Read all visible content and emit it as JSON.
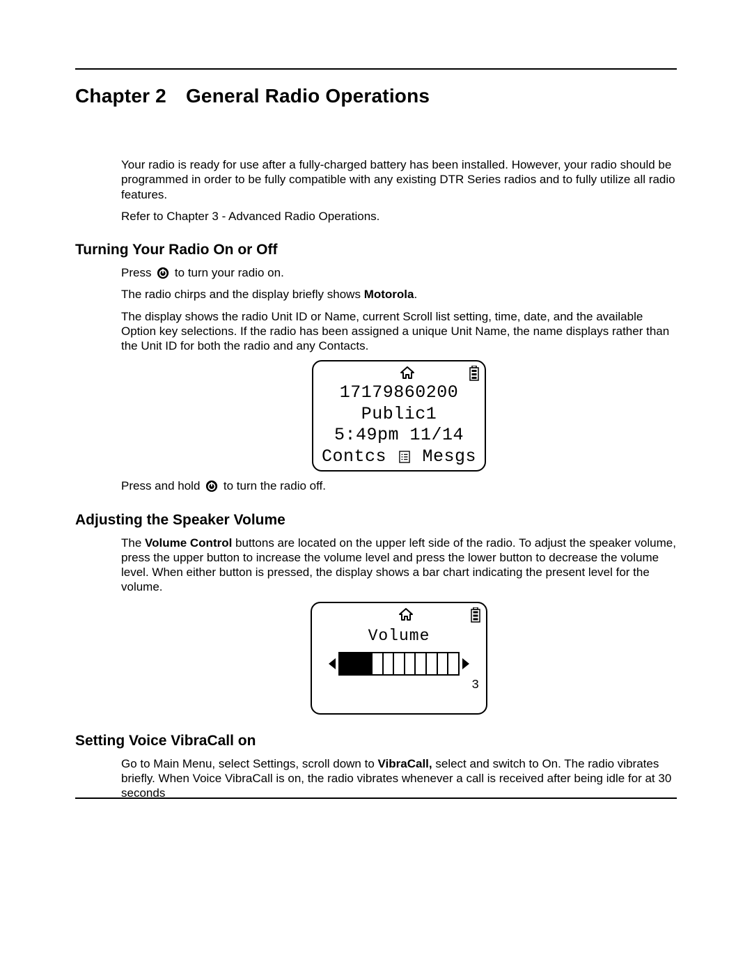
{
  "chapter": {
    "number_label": "Chapter 2",
    "title": "General Radio Operations"
  },
  "intro": {
    "p1": "Your radio is ready for use after a fully-charged battery has been installed. However, your radio should be programmed in order to be fully compatible with any existing DTR Series radios and to fully utilize all radio features.",
    "p2": "Refer to Chapter 3 - Advanced Radio Operations."
  },
  "sections": {
    "onoff": {
      "heading": "Turning Your Radio On or Off",
      "press_prefix": "Press ",
      "press_suffix": " to turn your radio on.",
      "chirps_prefix": "The radio chirps and the display briefly shows ",
      "chirps_bold": "Motorola",
      "chirps_suffix": ".",
      "display_para": "The display shows the radio Unit ID or Name, current Scroll list setting, time, date, and the available Option key selections. If the radio has been assigned a unique Unit Name, the name displays rather than the Unit ID for both the radio and any Contacts.",
      "hold_prefix": "Press and hold ",
      "hold_suffix": " to turn the radio off."
    },
    "volume": {
      "heading": "Adjusting the Speaker Volume",
      "para_prefix": "The ",
      "para_bold": "Volume Control",
      "para_suffix": " buttons are located on the upper left side of the radio. To adjust the speaker volume, press the upper button to increase the volume level and press the lower button to decrease the volume level. When either button is pressed, the display shows a bar chart indicating the present level for the volume."
    },
    "vibracall": {
      "heading": "Setting Voice VibraCall on",
      "para_prefix": "Go to Main Menu, select Settings, scroll down to ",
      "para_bold": "VibraCall,",
      "para_suffix": " select and switch to On. The radio vibrates briefly. When Voice VibraCall is on, the radio vibrates whenever a call is received after being idle for at 30 seconds"
    }
  },
  "screen_home": {
    "unit_id": "17179860200",
    "scroll_list": "Public1",
    "datetime": "5:49pm 11/14",
    "left_softkey": "Contcs",
    "right_softkey": "Mesgs"
  },
  "screen_volume": {
    "title": "Volume",
    "level": "3",
    "segments_total": 11,
    "segments_filled": 3
  }
}
